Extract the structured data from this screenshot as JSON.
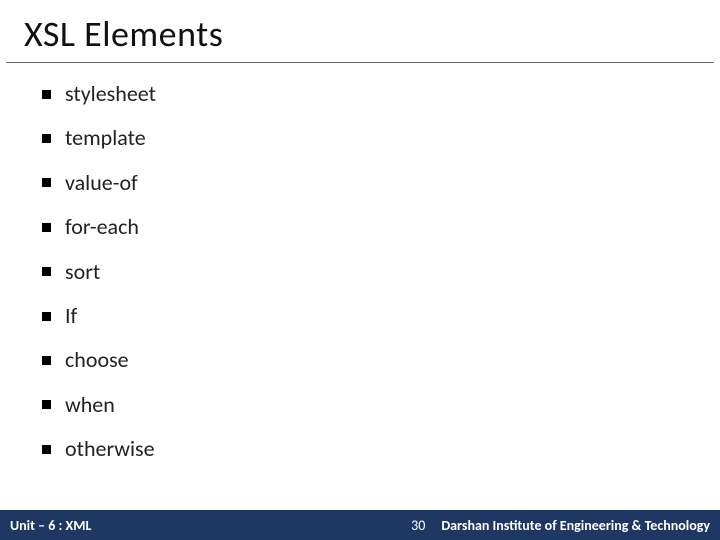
{
  "title": "XSL Elements",
  "bullets": {
    "items": [
      {
        "label": "stylesheet"
      },
      {
        "label": "template"
      },
      {
        "label": "value-of"
      },
      {
        "label": "for-each"
      },
      {
        "label": "sort"
      },
      {
        "label": "If"
      },
      {
        "label": "choose"
      },
      {
        "label": "when"
      },
      {
        "label": "otherwise"
      }
    ]
  },
  "footer": {
    "left": "Unit – 6 : XML",
    "page": "30",
    "right": "Darshan Institute of Engineering & Technology"
  }
}
